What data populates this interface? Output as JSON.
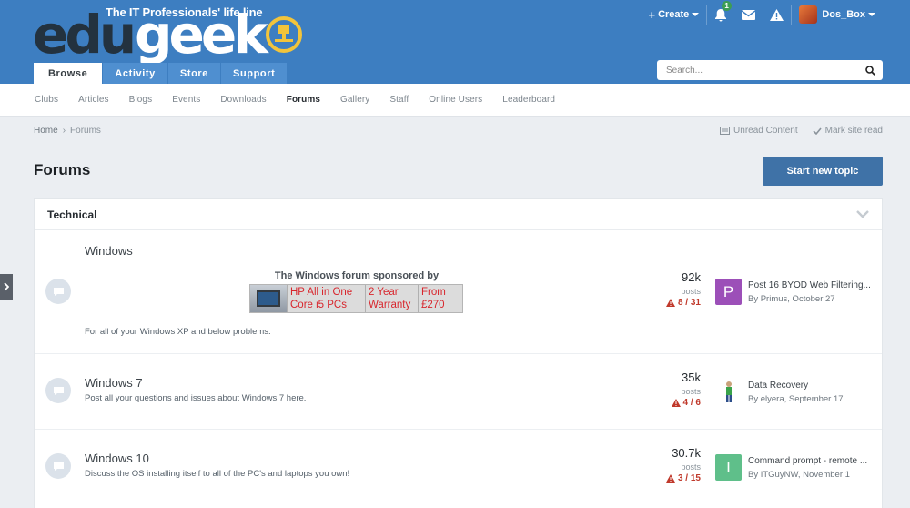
{
  "header": {
    "tagline": "The IT Professionals' life line",
    "logo_text_dark": "edu",
    "logo_text_light": "geek",
    "create_label": "Create",
    "notification_count": "1",
    "username": "Dos_Box",
    "tabs": [
      {
        "label": "Browse"
      },
      {
        "label": "Activity"
      },
      {
        "label": "Store"
      },
      {
        "label": "Support"
      }
    ],
    "search_placeholder": "Search..."
  },
  "subnav": [
    "Clubs",
    "Articles",
    "Blogs",
    "Events",
    "Downloads",
    "Forums",
    "Gallery",
    "Staff",
    "Online Users",
    "Leaderboard"
  ],
  "breadcrumb": {
    "home": "Home",
    "current": "Forums"
  },
  "actions": {
    "unread": "Unread Content",
    "mark_read": "Mark site read"
  },
  "page": {
    "title": "Forums",
    "new_topic": "Start new topic"
  },
  "category": {
    "title": "Technical",
    "forums": [
      {
        "title": "Windows",
        "description": "For all of your Windows XP and below problems.",
        "posts": "92k",
        "posts_label": "posts",
        "reports": "8 / 31",
        "last_title": "Post 16 BYOD Web Filtering...",
        "last_meta": "By Primus, October 27",
        "avatar_letter": "P",
        "avatar_color": "#9c4fb8",
        "sponsor_title": "The Windows forum sponsored by",
        "ad": {
          "col1a": "HP All in One",
          "col1b": "Core i5 PCs",
          "col2a": "2 Year",
          "col2b": "Warranty",
          "col3a": "From",
          "col3b": "£270"
        }
      },
      {
        "title": "Windows 7",
        "description": "Post all your questions and issues about Windows 7 here.",
        "posts": "35k",
        "posts_label": "posts",
        "reports": "4 / 6",
        "last_title": "Data Recovery",
        "last_meta": "By elyera, September 17"
      },
      {
        "title": "Windows 10",
        "description": "Discuss the OS installing itself to all of the PC's and laptops you own!",
        "posts": "30.7k",
        "posts_label": "posts",
        "reports": "3 / 15",
        "last_title": "Command prompt - remote ...",
        "last_meta": "By ITGuyNW, November 1",
        "avatar_letter": "I",
        "avatar_color": "#5fbf8a"
      }
    ]
  }
}
